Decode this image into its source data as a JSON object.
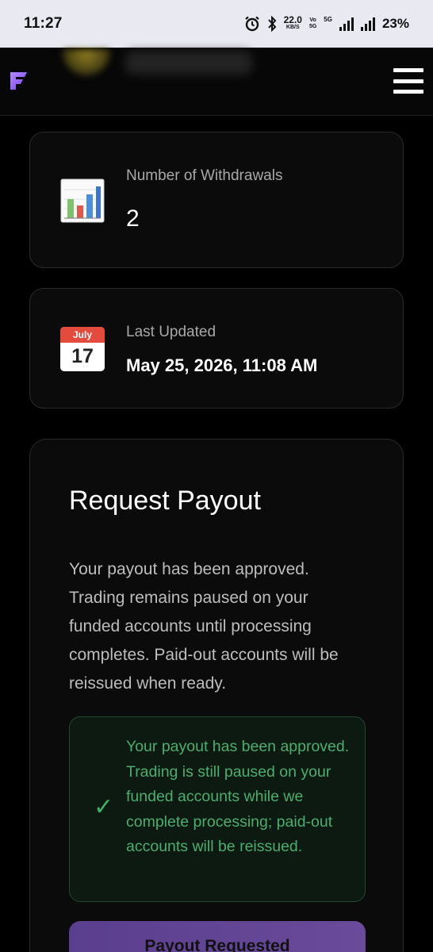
{
  "status_bar": {
    "time": "11:27",
    "net_speed": "22.0",
    "net_speed_unit": "KB/S",
    "volte_top": "Vo",
    "volte_bottom": "5G",
    "network_type": "5G",
    "battery": "23%"
  },
  "nav": {
    "logo_letter": "F",
    "accent": "#8a5cf6"
  },
  "stats": {
    "withdrawals": {
      "label": "Number of Withdrawals",
      "value": "2",
      "icon": "bar-chart-icon"
    },
    "last_updated": {
      "label": "Last Updated",
      "value": "May 25, 2026, 11:08 AM",
      "icon": "calendar-icon",
      "calendar_month": "July",
      "calendar_day": "17"
    }
  },
  "payout": {
    "title": "Request Payout",
    "description": "Your payout has been approved. Trading remains paused on your funded accounts until processing completes. Paid-out accounts will be reissued when ready.",
    "notice_icon": "check-icon",
    "notice_glyph": "✓",
    "notice_text": "Your payout has been approved. Trading is still paused on your funded accounts while we complete processing; paid-out accounts will be reissued.",
    "notice_color": "#4cae6e",
    "button_label": "Payout Requested"
  }
}
